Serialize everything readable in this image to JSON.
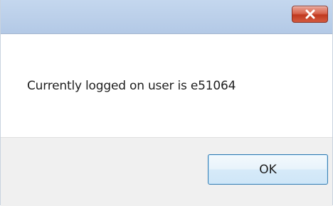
{
  "dialog": {
    "close_icon": "close-icon",
    "message": "Currently logged on user is e51064",
    "ok_label": "OK"
  },
  "colors": {
    "titlebar": "#bcd0ea",
    "close_button": "#c9472d",
    "footer": "#f0f0f0",
    "ok_border": "#3c7fb1"
  }
}
